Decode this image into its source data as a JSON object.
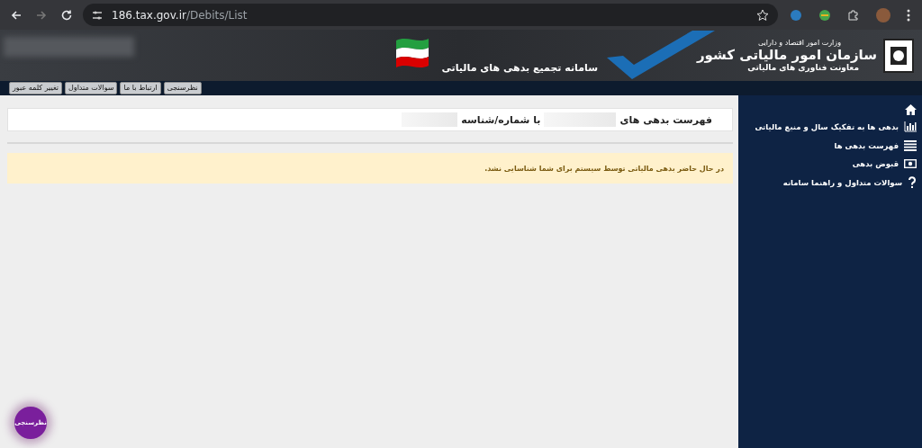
{
  "browser": {
    "url_host": "186.tax.gov.ir",
    "url_path": "/Debits/List"
  },
  "header": {
    "ministry": "وزارت امور اقتصاد و دارایی",
    "org": "سازمان امور مالیاتی کشور",
    "deputy": "معاونت فناوری های مالیاتی",
    "system": "سامانه تجمیع بدهی های مالیاتی"
  },
  "nav": [
    "نظرسنجی",
    "ارتباط با ما",
    "سوالات متداول",
    "تغییر کلمه عبور"
  ],
  "sidebar": {
    "items": [
      {
        "kind": "chart",
        "label": "بدهی ها به تفکیک سال و منبع مالیاتی"
      },
      {
        "kind": "list",
        "label": "فهرست بدهی ها"
      },
      {
        "kind": "money",
        "label": "قبوض بدهی"
      },
      {
        "kind": "help",
        "label": "سوالات متداول و راهنما سامانه"
      }
    ]
  },
  "page": {
    "title_start": "فهرست بدهی های",
    "title_mid": "با شماره/شناسه",
    "notice": "در حال حاضر بدهی مالیاتی توسط سیستم برای شما شناسایی نشد."
  },
  "survey_button": "نظرسنجی"
}
